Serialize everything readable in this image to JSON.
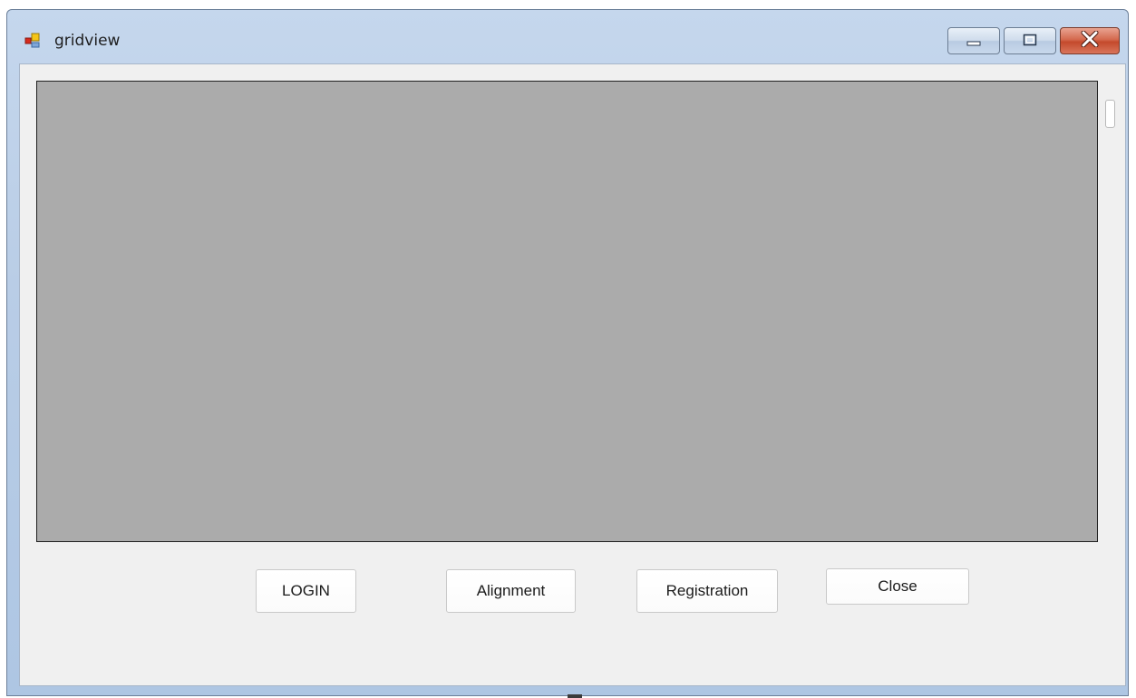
{
  "window": {
    "title": "gridview",
    "icon": "app-form-icon",
    "controls": {
      "minimize_icon": "minimize-icon",
      "maximize_icon": "maximize-icon",
      "close_icon": "close-icon"
    }
  },
  "buttons": {
    "login": "LOGIN",
    "alignment": "Alignment",
    "registration": "Registration",
    "close": "Close"
  },
  "colors": {
    "grid_background": "#ababab",
    "form_background": "#f0f0f0",
    "close_button": "#c44a2c"
  }
}
